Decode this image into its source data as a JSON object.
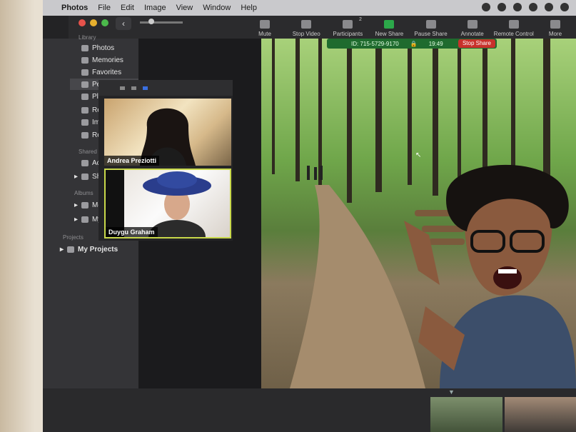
{
  "menubar": {
    "apple": "",
    "app": "Photos",
    "items": [
      "File",
      "Edit",
      "Image",
      "View",
      "Window",
      "Help"
    ]
  },
  "zoom_toolbar": [
    {
      "label": "Mute"
    },
    {
      "label": "Stop Video"
    },
    {
      "label": "Participants",
      "count": "2"
    },
    {
      "label": "New Share"
    },
    {
      "label": "Pause Share"
    },
    {
      "label": "Annotate"
    },
    {
      "label": "Remote Control"
    },
    {
      "label": "More"
    }
  ],
  "share_badge": {
    "id": "ID: 715-5729-9170",
    "time": "19:49",
    "stop_label": "Stop Share"
  },
  "sidebar": {
    "library_header": "Library",
    "library": [
      "Photos",
      "Memories",
      "Favorites",
      "Peopl",
      "Place",
      "Rece",
      "Impo",
      "Rece"
    ],
    "shared_header": "Shared",
    "shared": [
      "Activi",
      "Share"
    ],
    "albums_header": "Albums",
    "albums": [
      "Medi",
      "My A"
    ],
    "projects_header": "Projects",
    "projects": [
      "My Projects"
    ]
  },
  "participants": [
    {
      "name": "Andrea Preziotti"
    },
    {
      "name": "Duygu Graham"
    }
  ],
  "colors": {
    "share_green": "#1f6b2e",
    "stop_red": "#c8312b",
    "active_border": "#c8d84a"
  }
}
